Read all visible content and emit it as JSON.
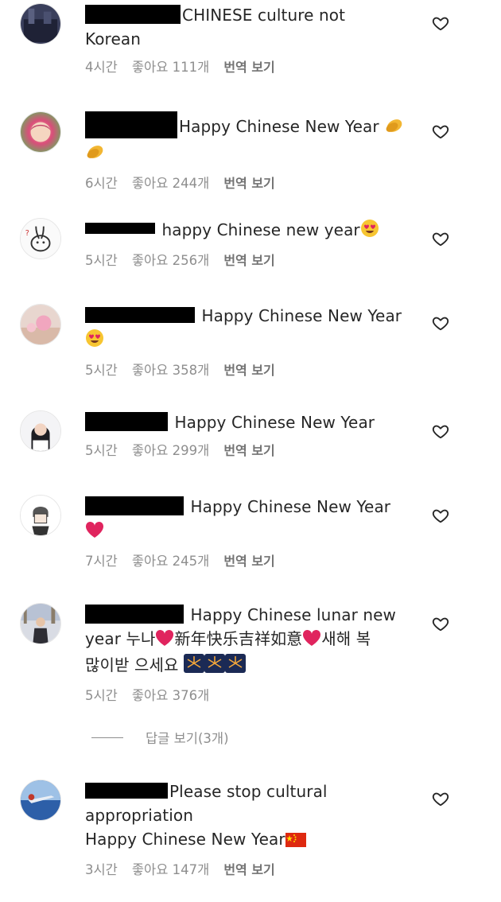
{
  "comments": [
    {
      "text_lines": [
        "CHINESE culture not",
        "Korean"
      ],
      "time": "4시간",
      "likes": "좋아요 111개",
      "translate": "번역 보기"
    },
    {
      "text": "Happy Chinese New Year",
      "time": "6시간",
      "likes": "좋아요 244개",
      "translate": "번역 보기"
    },
    {
      "text": "happy Chinese new year",
      "time": "5시간",
      "likes": "좋아요 256개",
      "translate": "번역 보기"
    },
    {
      "text": "Happy Chinese New Year",
      "time": "5시간",
      "likes": "좋아요 358개",
      "translate": "번역 보기"
    },
    {
      "text": "Happy Chinese New Year",
      "time": "5시간",
      "likes": "좋아요 299개",
      "translate": "번역 보기"
    },
    {
      "text": "Happy Chinese New Year",
      "time": "7시간",
      "likes": "좋아요 245개",
      "translate": "번역 보기"
    },
    {
      "text_lines": [
        "Happy Chinese lunar new",
        "year 누나",
        "新年快乐吉祥如意",
        "새해 복",
        "많이받 으세요"
      ],
      "time": "5시간",
      "likes": "좋아요 376개"
    },
    {
      "text_lines": [
        "Please stop cultural",
        "appropriation",
        "Happy Chinese New Year"
      ],
      "time": "3시간",
      "likes": "좋아요 147개",
      "translate": "번역 보기"
    }
  ],
  "view_replies": "답글 보기(3개)",
  "icons": {
    "like": "heart-outline-icon",
    "clap": "clapping-hands-emoji",
    "heart_eyes": "heart-eyes-emoji",
    "red_heart": "red-heart-emoji",
    "fireworks": "fireworks-emoji",
    "flag": "china-flag-emoji"
  },
  "colors": {
    "text": "#262626",
    "meta": "#8e8e8e",
    "heart_emoji": "#e0245e"
  }
}
